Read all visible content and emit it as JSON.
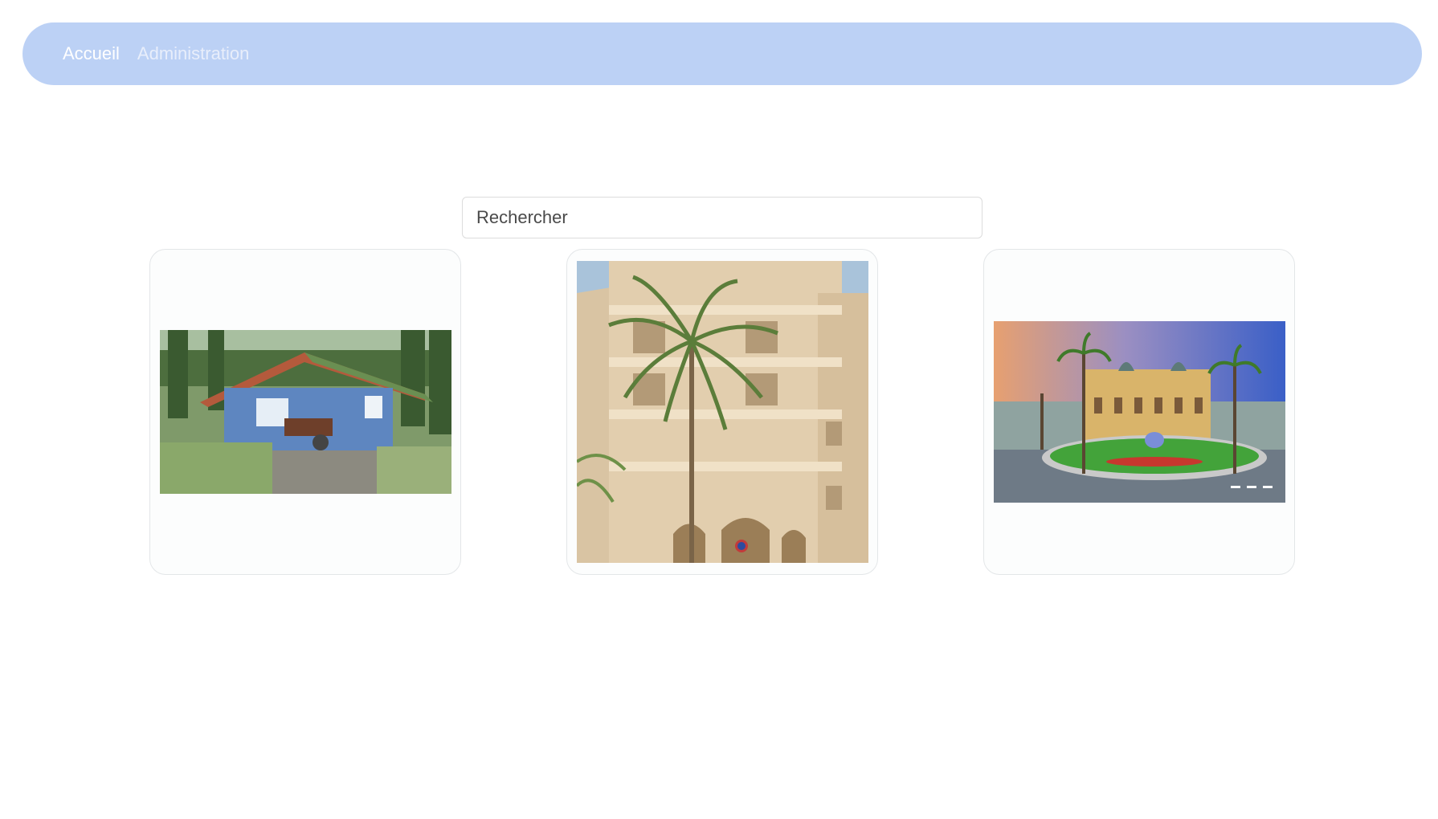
{
  "nav": {
    "items": [
      {
        "label": "Accueil",
        "active": true
      },
      {
        "label": "Administration",
        "active": false
      }
    ],
    "bg_color": "#bcd1f5"
  },
  "search": {
    "placeholder": "Rechercher",
    "value": ""
  },
  "listings": [
    {
      "image": "blue-wooden-cabin-photo"
    },
    {
      "image": "beige-apartment-building-palm-photo"
    },
    {
      "image": "casino-with-palm-trees-photo"
    }
  ]
}
